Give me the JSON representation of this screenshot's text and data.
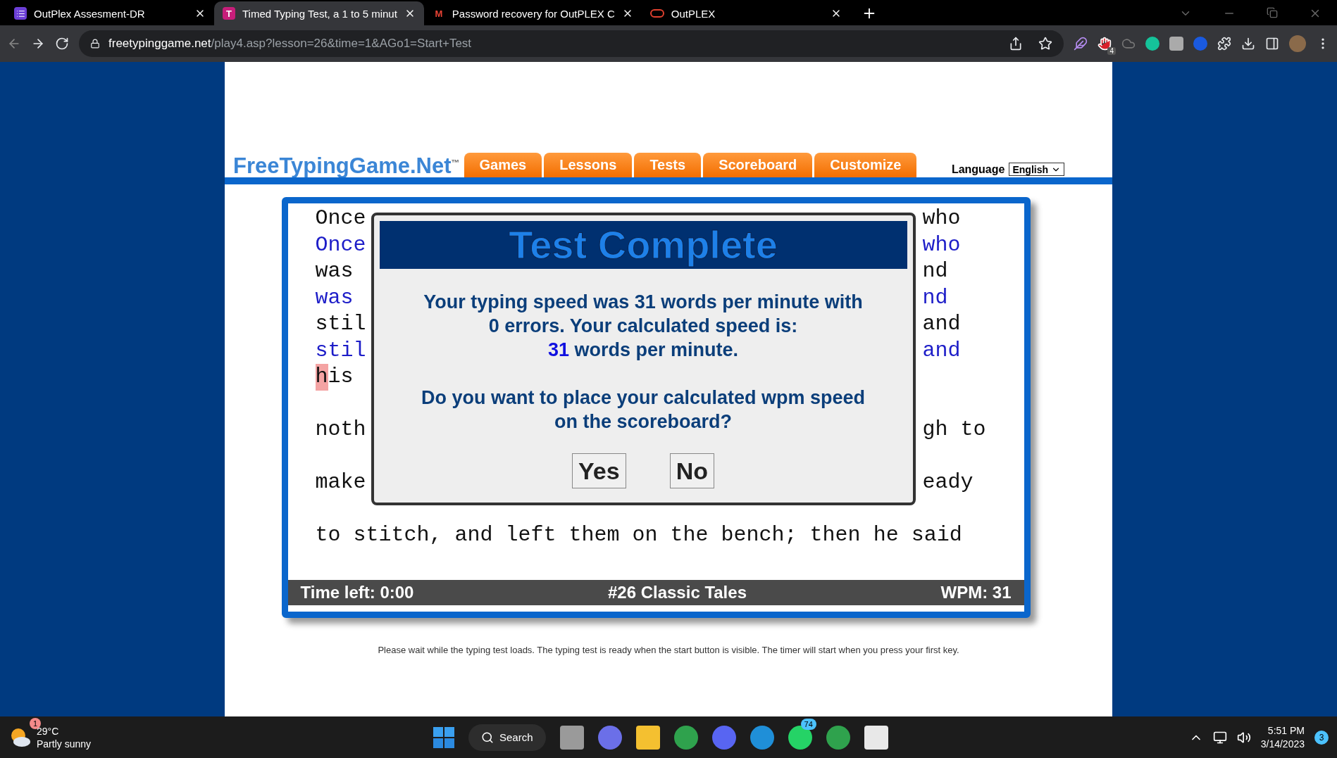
{
  "browser": {
    "tabs": [
      {
        "title": "OutPlex Assesment-DR",
        "kind": "list",
        "selected": false
      },
      {
        "title": "Timed Typing Test, a 1 to 5 minut",
        "kind": "letter",
        "icon_text": "T",
        "selected": true
      },
      {
        "title": "Password recovery for OutPLEX C",
        "kind": "mail",
        "icon_text": "M",
        "selected": false
      },
      {
        "title": "OutPLEX",
        "kind": "ring",
        "selected": false
      }
    ],
    "url_domain": "freetypinggame.net",
    "url_path": "/play4.asp?lesson=26&time=1&AGo1=Start+Test",
    "extension_badge": "4"
  },
  "site": {
    "logo": "FreeTypingGame.Net$^{™}$",
    "nav": [
      {
        "label": "Games"
      },
      {
        "label": "Lessons"
      },
      {
        "label": "Tests"
      },
      {
        "label": "Scoreboard"
      },
      {
        "label": "Customize"
      }
    ],
    "language_label": "Language",
    "language_value": "English"
  },
  "typing": {
    "lines": [
      {
        "kind": "split",
        "left": "Once",
        "right": "who",
        "typed": false
      },
      {
        "kind": "split",
        "left": "Once",
        "right": "who",
        "typed": true
      },
      {
        "kind": "split",
        "left": "was",
        "right": "nd",
        "typed": false
      },
      {
        "kind": "split",
        "left": "was",
        "right": "nd",
        "typed": true
      },
      {
        "kind": "split",
        "left": "stil",
        "right": "and",
        "typed": false
      },
      {
        "kind": "split",
        "left": "stil",
        "right": "and",
        "typed": true
      },
      {
        "kind": "cursor",
        "left_parts": [
          {
            "text": "h",
            "current": true
          },
          {
            "text": "is",
            "current": false
          }
        ],
        "typed": false
      },
      {
        "kind": "split",
        "left": "noth",
        "right": "gh to",
        "typed": false,
        "gap_before": true
      },
      {
        "kind": "split",
        "left": "make",
        "right": "eady",
        "typed": false,
        "gap_before": true
      },
      {
        "kind": "full",
        "full": "to stitch, and left them on the bench; then he said",
        "typed": false,
        "gap_before": true
      }
    ],
    "status": {
      "time_left": "Time left: 0:00",
      "lesson": "#26 Classic Tales",
      "wpm": "WPM: 31"
    }
  },
  "dialog": {
    "title": "Test Complete",
    "message": "Your typing speed was 31 words per minute with 0 errors. Your calculated speed is:",
    "speed_value": "31",
    "speed_unit": "words per minute.",
    "question": "Do you want to place your calculated wpm speed on the scoreboard?",
    "buttons": [
      "Yes",
      "No"
    ]
  },
  "note": "Please wait while the typing test loads. The typing test is ready when the start button is visible. The timer will start when you press your first key.",
  "taskbar": {
    "weather_temp": "29°C",
    "weather_text": "Partly sunny",
    "weather_badge": "1",
    "search": "Search",
    "whatsapp_badge": "74",
    "time": "5:51 PM",
    "date": "3/14/2023",
    "notifications": "3"
  }
}
